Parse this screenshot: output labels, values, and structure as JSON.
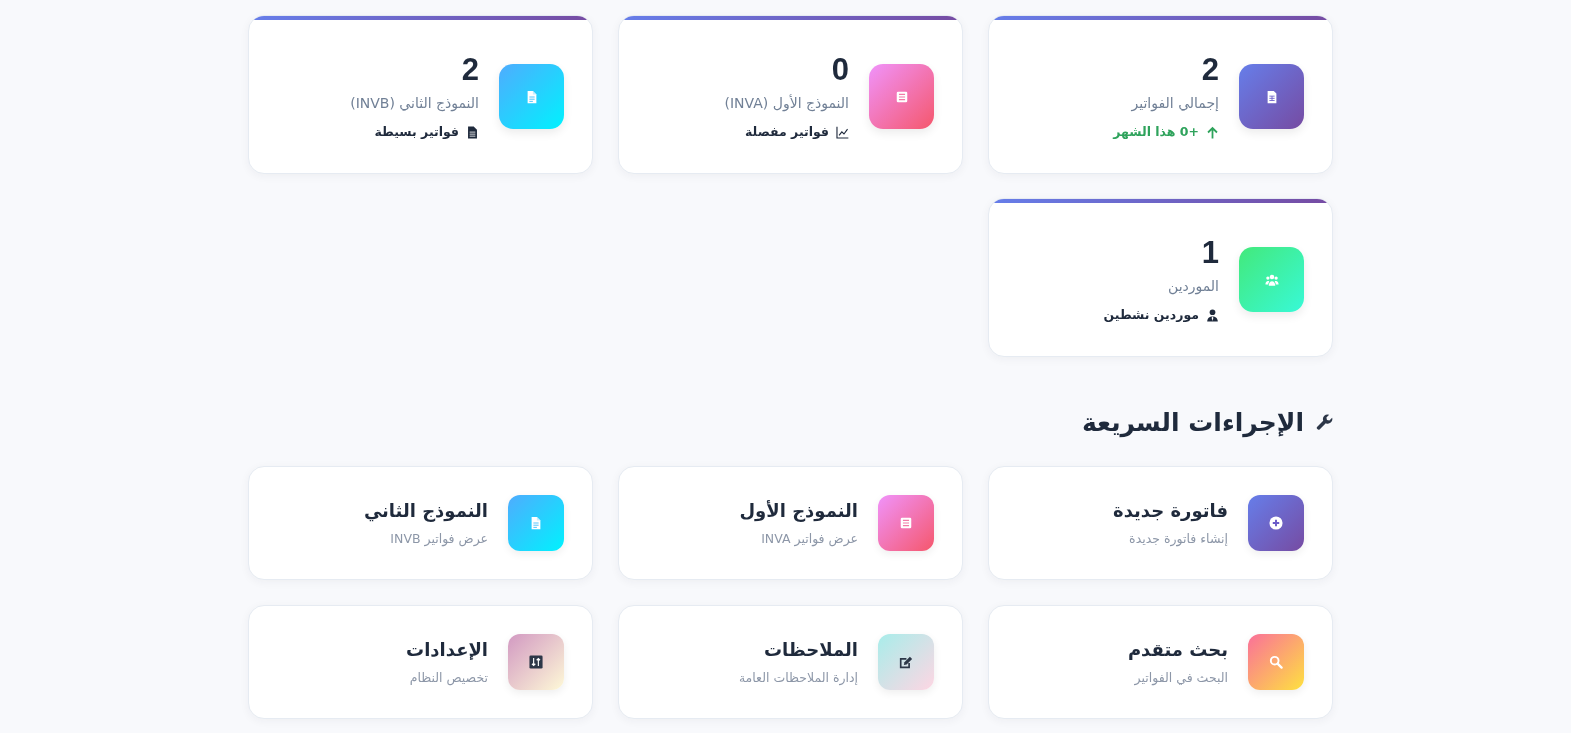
{
  "stats": [
    {
      "value": "2",
      "label": "إجمالي الفواتير",
      "footer": {
        "kind": "trend",
        "text": "+0 هذا الشهر"
      }
    },
    {
      "value": "0",
      "label": "النموذج الأول (INVA)",
      "footer": {
        "kind": "note",
        "text": "فواتير مفصلة"
      }
    },
    {
      "value": "2",
      "label": "النموذج الثاني (INVB)",
      "footer": {
        "kind": "note",
        "text": "فواتير بسيطة"
      }
    },
    {
      "value": "1",
      "label": "الموردين",
      "footer": {
        "kind": "note",
        "text": "موردين نشطين"
      }
    }
  ],
  "quick_actions": {
    "title": "الإجراءات السريعة",
    "items": [
      {
        "title": "فاتورة جديدة",
        "subtitle": "إنشاء فاتورة جديدة"
      },
      {
        "title": "النموذج الأول",
        "subtitle": "عرض فواتير INVA"
      },
      {
        "title": "النموذج الثاني",
        "subtitle": "عرض فواتير INVB"
      },
      {
        "title": "بحث متقدم",
        "subtitle": "البحث في الفواتير"
      },
      {
        "title": "الملاحظات",
        "subtitle": "إدارة الملاحظات العامة"
      },
      {
        "title": "الإعدادات",
        "subtitle": "تخصيص النظام"
      }
    ]
  }
}
